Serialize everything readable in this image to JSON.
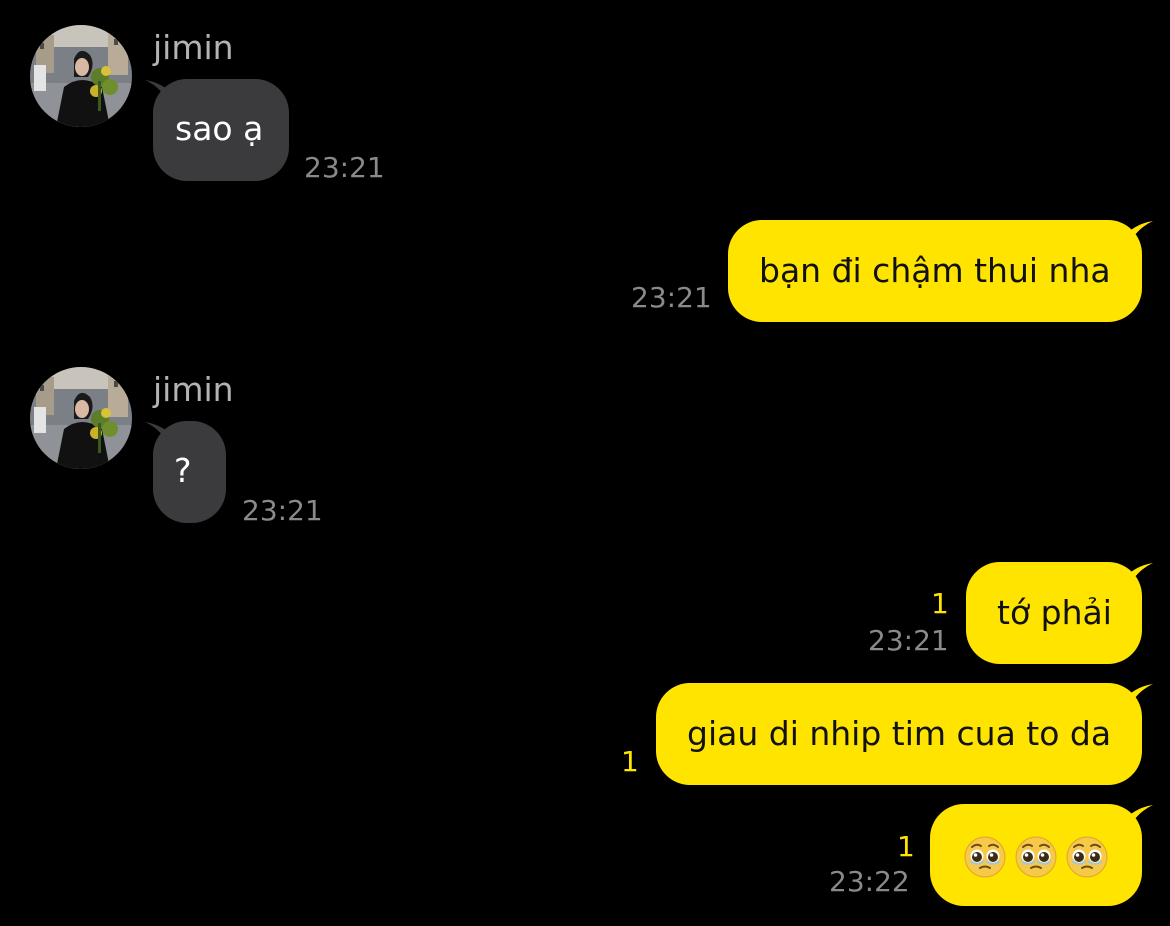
{
  "messages": [
    {
      "sender": "jimin",
      "text": "sao ạ",
      "time": "23:21"
    },
    {
      "text": "bạn đi chậm thui nha",
      "time": "23:21"
    },
    {
      "sender": "jimin",
      "text": "?",
      "time": "23:21"
    },
    {
      "text": "tớ phải",
      "time": "23:21",
      "unread": "1"
    },
    {
      "text": "giau di nhip tim cua to da",
      "unread": "1"
    },
    {
      "emojis": [
        "pleading-face",
        "pleading-face",
        "pleading-face"
      ],
      "time": "23:22",
      "unread": "1"
    }
  ],
  "colors": {
    "background": "#000000",
    "incoming_bubble": "#3b3b3d",
    "outgoing_bubble": "#ffe400",
    "timestamp": "#8a8a8a",
    "sender_name": "#b3b3b3",
    "unread_count": "#ffe400"
  }
}
